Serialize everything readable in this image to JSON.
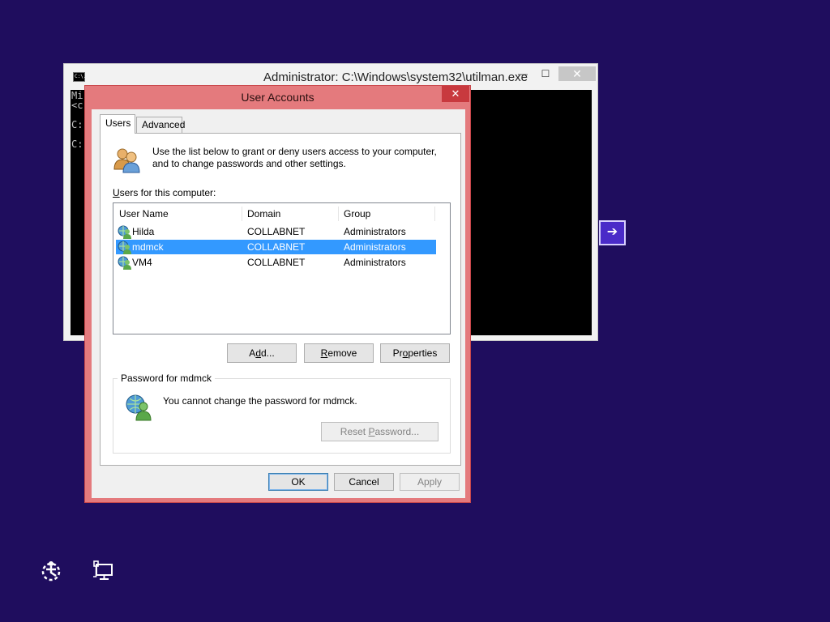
{
  "cmd": {
    "title": "Administrator: C:\\Windows\\system32\\utilman.exe",
    "icon_text": "C:\\.",
    "min_glyph": "—",
    "max_glyph": "☐",
    "close_glyph": "✕",
    "lines": [
      "Mi",
      "<c",
      "",
      "C:",
      "",
      "C:"
    ]
  },
  "side_arrow": {
    "glyph": "➔"
  },
  "dialog": {
    "title": "User Accounts",
    "close_glyph": "✕",
    "tabs": [
      {
        "label": "Users"
      },
      {
        "label": "Advanced"
      }
    ],
    "intro": "Use the list below to grant or deny users access to your computer, and to change passwords and other settings.",
    "users_label_u": "U",
    "users_label_rest": "sers for this computer:",
    "columns": [
      "User Name",
      "Domain",
      "Group"
    ],
    "users": [
      {
        "name": "Hilda",
        "domain": "COLLABNET",
        "group": "Administrators",
        "selected": false
      },
      {
        "name": "mdmck",
        "domain": "COLLABNET",
        "group": "Administrators",
        "selected": true
      },
      {
        "name": "VM4",
        "domain": "COLLABNET",
        "group": "Administrators",
        "selected": false
      }
    ],
    "add_pre": "A",
    "add_u": "d",
    "add_post": "d...",
    "remove_pre": "",
    "remove_u": "R",
    "remove_post": "emove",
    "properties_pre": "Pr",
    "properties_u": "o",
    "properties_post": "perties",
    "password_group": "Password for mdmck",
    "password_message": "You cannot change the password for mdmck.",
    "reset_pre": "Reset ",
    "reset_u": "P",
    "reset_post": "assword...",
    "ok": "OK",
    "cancel": "Cancel",
    "apply": "Apply"
  },
  "colors": {
    "desktop": "#1f0d5e",
    "dialog_frame": "#e47a7d",
    "selection": "#3399ff"
  },
  "icons": {
    "users": "users-group-icon",
    "user": "user-globe-icon",
    "ease_of_access": "ease-of-access-icon",
    "network": "network-icon"
  }
}
